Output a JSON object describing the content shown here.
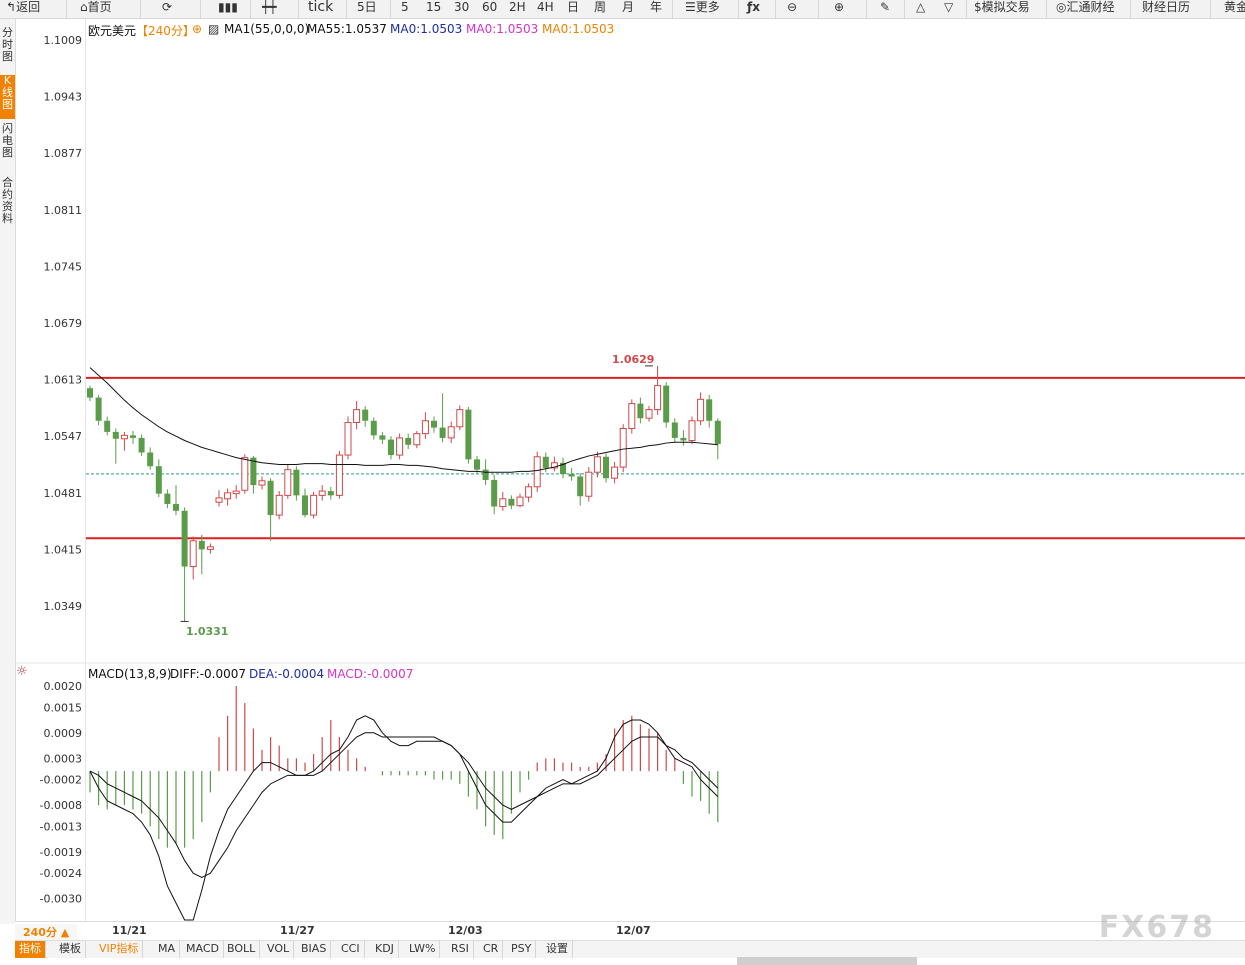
{
  "toolbar": {
    "items": [
      "返回",
      "首页",
      "tick",
      "5日",
      "5",
      "15",
      "30",
      "60",
      "2H",
      "4H",
      "日",
      "周",
      "月",
      "年",
      "更多",
      "模拟交易",
      "汇通财经",
      "财经日历",
      "黄金"
    ]
  },
  "leftnav": {
    "items": [
      "分时图",
      "K线图",
      "闪电图",
      "合约资料"
    ],
    "active": 1
  },
  "main_legend": {
    "symbol": "欧元美元",
    "period": "【240分】",
    "ma_params": "MA1(55,0,0,0)",
    "ma55": "MA55:1.0537",
    "ma0_a": "MA0:1.0503",
    "ma0_b": "MA0:1.0503",
    "ma0_c": "MA0:1.0503"
  },
  "macd_legend": {
    "name": "MACD(13,8,9)",
    "diff": "DIFF:-0.0007",
    "dea": "DEA:-0.0004",
    "macd": "MACD:-0.0007"
  },
  "price_labels": {
    "high": "1.0629",
    "low": "1.0331"
  },
  "x_labels": [
    "11/21",
    "11/27",
    "12/03",
    "12/07"
  ],
  "bottom_tabs": [
    "指标",
    "模板",
    "VIP指标",
    "MA",
    "MACD",
    "BOLL",
    "VOL",
    "BIAS",
    "CCI",
    "KDJ",
    "LW%",
    "RSI",
    "CR",
    "PSY",
    "设置"
  ],
  "period_badge": "240分",
  "watermark": "FX678",
  "colors": {
    "up": "#d0494b",
    "down": "#5a9c4a",
    "hline": "#e01f1f",
    "accent": "#f08200",
    "dea": "#3f3fa8",
    "macd": "#d535c9"
  },
  "chart_data": {
    "type": "candlestick",
    "ylim": [
      1.03,
      1.103
    ],
    "yticks": [
      1.1009,
      1.0943,
      1.0877,
      1.0811,
      1.0745,
      1.0679,
      1.0613,
      1.0547,
      1.0481,
      1.0415,
      1.0349
    ],
    "ma55": [
      1.0627,
      1.0618,
      1.0609,
      1.0599,
      1.0589,
      1.058,
      1.0572,
      1.0565,
      1.0558,
      1.0552,
      1.0547,
      1.0542,
      1.0538,
      1.0534,
      1.0531,
      1.0528,
      1.0525,
      1.0522,
      1.052,
      1.0518,
      1.0516,
      1.0515,
      1.0514,
      1.0514,
      1.0514,
      1.0515,
      1.0515,
      1.0515,
      1.0514,
      1.0514,
      1.0514,
      1.0514,
      1.0513,
      1.0513,
      1.0513,
      1.0514,
      1.0514,
      1.0513,
      1.0513,
      1.0512,
      1.0511,
      1.0509,
      1.0508,
      1.0507,
      1.0506,
      1.0506,
      1.0505,
      1.0505,
      1.0505,
      1.0505,
      1.0506,
      1.0506,
      1.0507,
      1.0509,
      1.0511,
      1.0514,
      1.0518,
      1.0521,
      1.0524,
      1.0526,
      1.0528,
      1.053,
      1.0532,
      1.0533,
      1.0534,
      1.0536,
      1.0537,
      1.0539,
      1.054,
      1.054,
      1.054,
      1.0539,
      1.0538,
      1.0537
    ],
    "candles": [
      [
        1.0603,
        1.0592,
        1.0606,
        1.0588
      ],
      [
        1.0592,
        1.0565,
        1.0595,
        1.056
      ],
      [
        1.0565,
        1.0552,
        1.057,
        1.0548
      ],
      [
        1.0552,
        1.0544,
        1.0556,
        1.0515
      ],
      [
        1.0544,
        1.0548,
        1.0552,
        1.053
      ],
      [
        1.0548,
        1.0545,
        1.0553,
        1.0538
      ],
      [
        1.0545,
        1.0528,
        1.0549,
        1.0524
      ],
      [
        1.0528,
        1.0512,
        1.0534,
        1.0508
      ],
      [
        1.0512,
        1.048,
        1.052,
        1.0476
      ],
      [
        1.048,
        1.0468,
        1.0485,
        1.0463
      ],
      [
        1.0468,
        1.046,
        1.049,
        1.0455
      ],
      [
        1.046,
        1.0395,
        1.0464,
        1.0331
      ],
      [
        1.0395,
        1.0425,
        1.043,
        1.038
      ],
      [
        1.0425,
        1.0415,
        1.0432,
        1.0386
      ],
      [
        1.0415,
        1.0418,
        1.0422,
        1.041
      ],
      [
        1.047,
        1.0475,
        1.0484,
        1.0465
      ],
      [
        1.0474,
        1.0481,
        1.0486,
        1.0466
      ],
      [
        1.048,
        1.0483,
        1.049,
        1.0474
      ],
      [
        1.0484,
        1.0522,
        1.0526,
        1.048
      ],
      [
        1.0522,
        1.049,
        1.0524,
        1.048
      ],
      [
        1.049,
        1.0495,
        1.05,
        1.0485
      ],
      [
        1.0495,
        1.0455,
        1.0498,
        1.0425
      ],
      [
        1.0455,
        1.0478,
        1.0483,
        1.045
      ],
      [
        1.0478,
        1.0508,
        1.0514,
        1.0474
      ],
      [
        1.0508,
        1.0478,
        1.0512,
        1.0472
      ],
      [
        1.0478,
        1.0455,
        1.0486,
        1.0452
      ],
      [
        1.0455,
        1.0478,
        1.0482,
        1.0451
      ],
      [
        1.0478,
        1.0483,
        1.049,
        1.0472
      ],
      [
        1.0483,
        1.0478,
        1.0488,
        1.0473
      ],
      [
        1.0478,
        1.0525,
        1.053,
        1.0474
      ],
      [
        1.0525,
        1.0563,
        1.057,
        1.052
      ],
      [
        1.0563,
        1.0578,
        1.0588,
        1.0555
      ],
      [
        1.0578,
        1.0565,
        1.0582,
        1.0558
      ],
      [
        1.0565,
        1.0548,
        1.0569,
        1.0543
      ],
      [
        1.0548,
        1.0543,
        1.0552,
        1.0538
      ],
      [
        1.0543,
        1.0525,
        1.0547,
        1.052
      ],
      [
        1.0525,
        1.0545,
        1.055,
        1.052
      ],
      [
        1.0545,
        1.0537,
        1.055,
        1.0532
      ],
      [
        1.0537,
        1.055,
        1.0553,
        1.0533
      ],
      [
        1.055,
        1.0565,
        1.0575,
        1.0544
      ],
      [
        1.0565,
        1.0557,
        1.057,
        1.0551
      ],
      [
        1.0557,
        1.0545,
        1.0597,
        1.054
      ],
      [
        1.0545,
        1.0558,
        1.0564,
        1.0539
      ],
      [
        1.0558,
        1.0578,
        1.0583,
        1.0554
      ],
      [
        1.0578,
        1.052,
        1.0581,
        1.0515
      ],
      [
        1.052,
        1.0508,
        1.0524,
        1.0503
      ],
      [
        1.0508,
        1.0496,
        1.052,
        1.049
      ],
      [
        1.0496,
        1.0465,
        1.0502,
        1.0456
      ],
      [
        1.0465,
        1.0474,
        1.0482,
        1.046
      ],
      [
        1.0474,
        1.0466,
        1.0478,
        1.0462
      ],
      [
        1.0466,
        1.0476,
        1.048,
        1.0464
      ],
      [
        1.0476,
        1.0488,
        1.0492,
        1.047
      ],
      [
        1.0488,
        1.0523,
        1.0529,
        1.0482
      ],
      [
        1.0523,
        1.051,
        1.0528,
        1.0505
      ],
      [
        1.051,
        1.0516,
        1.0523,
        1.0506
      ],
      [
        1.0516,
        1.0503,
        1.0522,
        1.0498
      ],
      [
        1.0503,
        1.05,
        1.051,
        1.0495
      ],
      [
        1.05,
        1.0477,
        1.0504,
        1.0466
      ],
      [
        1.0477,
        1.0505,
        1.0511,
        1.0471
      ],
      [
        1.0505,
        1.0523,
        1.0529,
        1.0499
      ],
      [
        1.0523,
        1.0498,
        1.0527,
        1.0493
      ],
      [
        1.0498,
        1.0511,
        1.0517,
        1.0492
      ],
      [
        1.0511,
        1.0556,
        1.0561,
        1.0505
      ],
      [
        1.0556,
        1.0585,
        1.059,
        1.055
      ],
      [
        1.0585,
        1.0568,
        1.0592,
        1.0562
      ],
      [
        1.0568,
        1.0578,
        1.0582,
        1.0564
      ],
      [
        1.0578,
        1.0606,
        1.0629,
        1.0572
      ],
      [
        1.0606,
        1.0563,
        1.061,
        1.0557
      ],
      [
        1.0563,
        1.0545,
        1.0568,
        1.054
      ],
      [
        1.0545,
        1.0542,
        1.0554,
        1.0536
      ],
      [
        1.0542,
        1.0565,
        1.057,
        1.0538
      ],
      [
        1.0565,
        1.059,
        1.0598,
        1.056
      ],
      [
        1.059,
        1.0565,
        1.0595,
        1.0557
      ],
      [
        1.0565,
        1.0538,
        1.0568,
        1.052
      ]
    ],
    "hlines": [
      1.0615,
      1.0428
    ],
    "current_line": 1.0503,
    "macd": {
      "ylim": [
        -0.0035,
        0.0024
      ],
      "yticks": [
        0.002,
        0.0015,
        0.0009,
        0.0003,
        -0.0002,
        -0.0008,
        -0.0013,
        -0.0019,
        -0.0024,
        -0.003
      ],
      "diff": [
        0.0,
        -0.0004,
        -0.0007,
        -0.0008,
        -0.0009,
        -0.001,
        -0.0012,
        -0.0015,
        -0.002,
        -0.0027,
        -0.0031,
        -0.0035,
        -0.0035,
        -0.0028,
        -0.002,
        -0.0014,
        -0.0009,
        -0.0006,
        -0.0003,
        0.0,
        0.0002,
        0.0002,
        0.0001,
        0.0,
        -0.0001,
        -0.0001,
        0.0,
        0.0002,
        0.0004,
        0.0005,
        0.0008,
        0.0012,
        0.0013,
        0.0012,
        0.0009,
        0.0007,
        0.0006,
        0.0006,
        0.0007,
        0.0007,
        0.0007,
        0.0007,
        0.0006,
        0.0004,
        0.0,
        -0.0004,
        -0.0008,
        -0.001,
        -0.0012,
        -0.0012,
        -0.001,
        -0.0008,
        -0.0006,
        -0.0004,
        -0.0003,
        -0.0002,
        -0.0003,
        -0.0002,
        -0.0001,
        0.0,
        0.0003,
        0.0008,
        0.0011,
        0.0012,
        0.0012,
        0.0011,
        0.0009,
        0.0006,
        0.0003,
        0.0002,
        0.0001,
        -0.0002,
        -0.0004,
        -0.0006
      ],
      "dea": [
        0.0,
        -0.0001,
        -0.0003,
        -0.0004,
        -0.0005,
        -0.0006,
        -0.0007,
        -0.0009,
        -0.0011,
        -0.0014,
        -0.0017,
        -0.0021,
        -0.0024,
        -0.0025,
        -0.0024,
        -0.0021,
        -0.0018,
        -0.0014,
        -0.0011,
        -0.0008,
        -0.0005,
        -0.0003,
        -0.0002,
        -0.0001,
        -0.0001,
        -0.0001,
        -0.0001,
        0.0,
        0.0002,
        0.0004,
        0.0006,
        0.0008,
        0.0009,
        0.0009,
        0.0008,
        0.0008,
        0.0008,
        0.0008,
        0.0008,
        0.0008,
        0.0008,
        0.0007,
        0.0006,
        0.0004,
        0.0002,
        -0.0001,
        -0.0004,
        -0.0006,
        -0.0008,
        -0.0009,
        -0.0008,
        -0.0007,
        -0.0006,
        -0.0005,
        -0.0004,
        -0.0003,
        -0.0003,
        -0.0003,
        -0.0002,
        -0.0001,
        0.0001,
        0.0003,
        0.0005,
        0.0007,
        0.0008,
        0.0008,
        0.0008,
        0.0006,
        0.0005,
        0.0003,
        0.0002,
        0.0,
        -0.0002,
        -0.0004
      ],
      "hist": [
        -0.0005,
        -0.0008,
        -0.0009,
        -0.0008,
        -0.0008,
        -0.0009,
        -0.001,
        -0.0013,
        -0.0016,
        -0.0018,
        -0.0017,
        -0.0018,
        -0.0016,
        -0.0012,
        -0.0005,
        0.0008,
        0.0013,
        0.002,
        0.0016,
        0.001,
        0.0005,
        0.0008,
        0.0006,
        0.0003,
        0.0003,
        0.0002,
        0.0004,
        0.0008,
        0.0012,
        0.0008,
        0.0005,
        0.0003,
        0.0001,
        0.0,
        -0.0001,
        -0.0001,
        -0.0001,
        -0.0001,
        -0.0001,
        -0.0001,
        -0.0002,
        -0.0002,
        -0.0002,
        -0.0003,
        -0.0006,
        -0.0009,
        -0.0013,
        -0.0015,
        -0.0016,
        -0.001,
        -0.0005,
        -0.0002,
        0.0002,
        0.0003,
        0.0003,
        0.0002,
        0.0002,
        0.0001,
        0.0001,
        0.0002,
        0.0004,
        0.001,
        0.0012,
        0.0013,
        0.0011,
        0.001,
        0.0009,
        0.0005,
        0.0003,
        -0.0003,
        -0.0006,
        -0.0007,
        -0.001,
        -0.0012
      ]
    }
  }
}
